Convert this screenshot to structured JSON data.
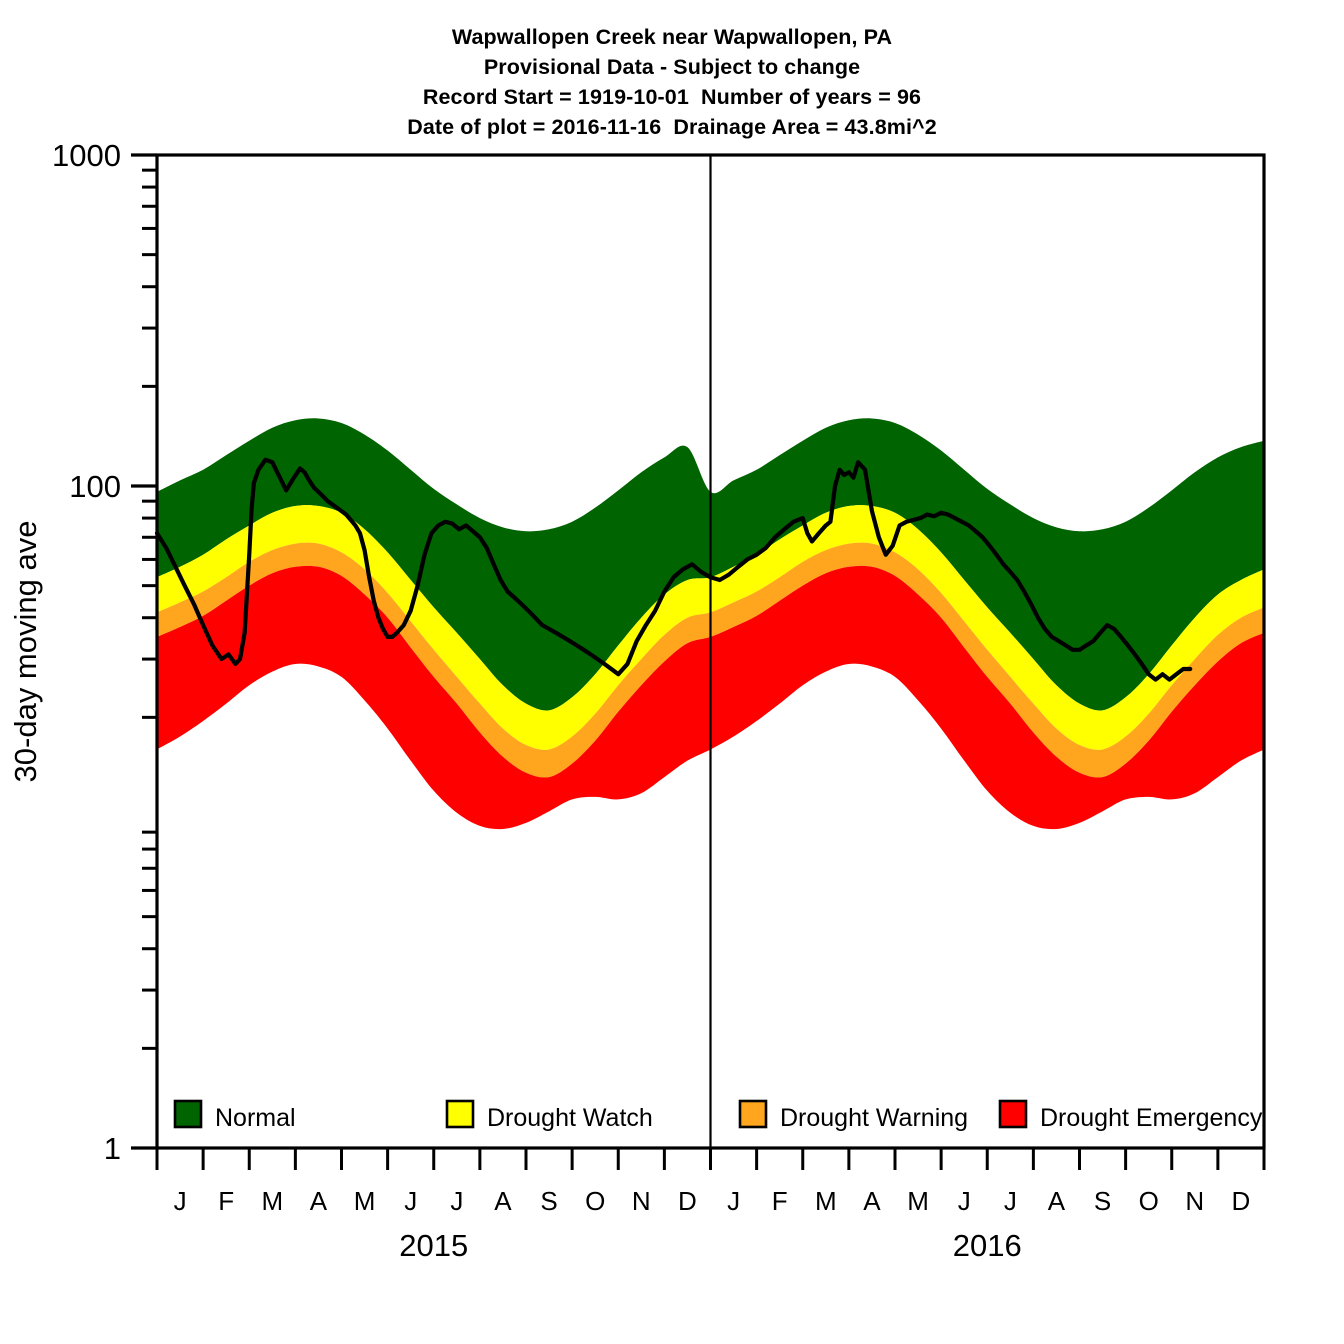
{
  "title": {
    "line1": "Wapwallopen Creek near Wapwallopen, PA",
    "line2": "Provisional Data - Subject to change",
    "line3": "Record Start = 1919-10-01  Number of years = 96",
    "line4": "Date of plot = 2016-11-16  Drainage Area = 43.8mi^2"
  },
  "legend": {
    "items": [
      {
        "label": "Normal",
        "color": "#006400"
      },
      {
        "label": "Drought Watch",
        "color": "#ffff00"
      },
      {
        "label": "Drought Warning",
        "color": "#ffa51e"
      },
      {
        "label": "Drought Emergency",
        "color": "#ff0000"
      }
    ]
  },
  "axes": {
    "ylabel": "30-day moving ave",
    "y_ticks_major": [
      "1",
      "100",
      "1000"
    ],
    "y_tick_values": [
      1,
      100,
      1000
    ],
    "y_minor_values": [
      2,
      3,
      4,
      5,
      6,
      7,
      8,
      9,
      20,
      30,
      40,
      50,
      60,
      70,
      80,
      90,
      200,
      300,
      400,
      500,
      600,
      700,
      800,
      900
    ],
    "ylim": [
      1,
      1000
    ],
    "x_months": [
      "J",
      "F",
      "M",
      "A",
      "M",
      "J",
      "J",
      "A",
      "S",
      "O",
      "N",
      "D"
    ],
    "year_labels": [
      "2015",
      "2016"
    ],
    "xlim": [
      "2015-01-01",
      "2016-12-31"
    ]
  },
  "chart_data": {
    "type": "area",
    "title": "Wapwallopen Creek near Wapwallopen, PA",
    "subtitle": "Provisional Data - Subject to change",
    "xlabel": "",
    "ylabel": "30-day moving ave",
    "yscale": "log",
    "ylim": [
      1,
      1000
    ],
    "grid": false,
    "legend_position": "bottom-inside",
    "x_unit": "month index (0 = 2015-01-01, 24 = 2017-01-01)",
    "x": [
      0,
      0.5,
      1,
      1.5,
      2,
      2.5,
      3,
      3.5,
      4,
      4.5,
      5,
      5.5,
      6,
      6.5,
      7,
      7.5,
      8,
      8.5,
      9,
      9.5,
      10,
      10.5,
      11,
      11.5,
      12,
      12.5,
      13,
      13.5,
      14,
      14.5,
      15,
      15.5,
      16,
      16.5,
      17,
      17.5,
      18,
      18.5,
      19,
      19.5,
      20,
      20.5,
      21,
      21.5,
      22,
      22.5,
      23,
      23.5,
      24
    ],
    "bands": [
      {
        "name": "Normal",
        "color": "#006400",
        "role": "upper envelope of normal band (90th-ish percentile)",
        "upper": [
          96,
          104,
          112,
          124,
          137,
          150,
          158,
          160,
          155,
          143,
          128,
          112,
          98,
          88,
          80,
          75,
          73,
          74,
          78,
          86,
          97,
          110,
          122,
          131,
          96,
          104,
          112,
          124,
          137,
          150,
          158,
          160,
          155,
          143,
          128,
          112,
          98,
          88,
          80,
          75,
          73,
          74,
          78,
          86,
          97,
          110,
          122,
          131,
          137
        ],
        "lower": [
          53,
          57,
          62,
          69,
          76,
          83,
          87,
          87,
          83,
          74,
          63,
          52,
          43,
          36,
          30,
          25,
          22,
          21,
          23,
          27,
          33,
          40,
          47,
          52,
          53,
          57,
          62,
          69,
          76,
          83,
          87,
          87,
          83,
          74,
          63,
          52,
          43,
          36,
          30,
          25,
          22,
          21,
          23,
          27,
          33,
          40,
          47,
          52,
          56
        ]
      },
      {
        "name": "Drought Watch",
        "color": "#ffff00",
        "upper": [
          53,
          57,
          62,
          69,
          76,
          83,
          87,
          87,
          83,
          74,
          63,
          52,
          43,
          36,
          30,
          25,
          22,
          21,
          23,
          27,
          33,
          40,
          47,
          52,
          53,
          57,
          62,
          69,
          76,
          83,
          87,
          87,
          83,
          74,
          63,
          52,
          43,
          36,
          30,
          25,
          22,
          21,
          23,
          27,
          33,
          40,
          47,
          52,
          56
        ],
        "lower": [
          41.5,
          44.5,
          48,
          53,
          59,
          64,
          67,
          67,
          63,
          56,
          47.5,
          39,
          32,
          26.5,
          22,
          18.5,
          16.5,
          16,
          17.5,
          20.5,
          25,
          30,
          35.5,
          40,
          41.5,
          44.5,
          48,
          53,
          59,
          64,
          67,
          67,
          63,
          56,
          47.5,
          39,
          32,
          26.5,
          22,
          18.5,
          16.5,
          16,
          17.5,
          20.5,
          25,
          30,
          35.5,
          40,
          43
        ]
      },
      {
        "name": "Drought Warning",
        "color": "#ffa51e",
        "upper": [
          41.5,
          44.5,
          48,
          53,
          59,
          64,
          67,
          67,
          63,
          56,
          47.5,
          39,
          32,
          26.5,
          22,
          18.5,
          16.5,
          16,
          17.5,
          20.5,
          25,
          30,
          35.5,
          40,
          41.5,
          44.5,
          48,
          53,
          59,
          64,
          67,
          67,
          63,
          56,
          47.5,
          39,
          32,
          26.5,
          22,
          18.5,
          16.5,
          16,
          17.5,
          20.5,
          25,
          30,
          35.5,
          40,
          43
        ],
        "lower": [
          35,
          37.5,
          40.5,
          45,
          50,
          54.5,
          57,
          57,
          53.5,
          47,
          40,
          32.5,
          26.5,
          22,
          18,
          15.2,
          13.6,
          13.2,
          14.5,
          17,
          20.8,
          25,
          29.5,
          33.5,
          35,
          37.5,
          40.5,
          45,
          50,
          54.5,
          57,
          57,
          53.5,
          47,
          40,
          32.5,
          26.5,
          22,
          18,
          15.2,
          13.6,
          13.2,
          14.5,
          17,
          20.8,
          25,
          29.5,
          33.5,
          36
        ]
      },
      {
        "name": "Drought Emergency",
        "color": "#ff0000",
        "upper": [
          35,
          37.5,
          40.5,
          45,
          50,
          54.5,
          57,
          57,
          53.5,
          47,
          40,
          32.5,
          26.5,
          22,
          18,
          15.2,
          13.6,
          13.2,
          14.5,
          17,
          20.8,
          25,
          29.5,
          33.5,
          35,
          37.5,
          40.5,
          45,
          50,
          54.5,
          57,
          57,
          53.5,
          47,
          40,
          32.5,
          26.5,
          22,
          18,
          15.2,
          13.6,
          13.2,
          14.5,
          17,
          20.8,
          25,
          29.5,
          33.5,
          36
        ],
        "lower": [
          16,
          17.5,
          19.5,
          22,
          25,
          27.5,
          29,
          28.5,
          26.5,
          22.5,
          18.5,
          14.8,
          12,
          10.3,
          9.4,
          9.2,
          9.6,
          10.4,
          11.3,
          11.5,
          11.3,
          11.8,
          13.2,
          14.8,
          16,
          17.5,
          19.5,
          22,
          25,
          27.5,
          29,
          28.5,
          26.5,
          22.5,
          18.5,
          14.8,
          12,
          10.3,
          9.4,
          9.2,
          9.6,
          10.4,
          11.3,
          11.5,
          11.3,
          11.8,
          13.2,
          14.8,
          16
        ]
      }
    ],
    "series": [
      {
        "name": "30-day moving average streamflow",
        "color": "#000000",
        "x": [
          0.0,
          0.2,
          0.4,
          0.6,
          0.8,
          1.0,
          1.2,
          1.4,
          1.55,
          1.7,
          1.8,
          1.9,
          2.0,
          2.05,
          2.1,
          2.2,
          2.35,
          2.5,
          2.65,
          2.8,
          2.95,
          3.1,
          3.2,
          3.3,
          3.4,
          3.5,
          3.6,
          3.7,
          3.8,
          3.9,
          4.0,
          4.1,
          4.2,
          4.3,
          4.4,
          4.5,
          4.6,
          4.7,
          4.8,
          4.9,
          5.0,
          5.1,
          5.2,
          5.35,
          5.5,
          5.65,
          5.8,
          5.95,
          6.1,
          6.25,
          6.4,
          6.55,
          6.7,
          6.85,
          7.0,
          7.15,
          7.3,
          7.45,
          7.6,
          7.75,
          7.9,
          8.05,
          8.2,
          8.35,
          8.5,
          8.65,
          8.8,
          8.95,
          9.1,
          9.25,
          9.4,
          9.55,
          9.7,
          9.85,
          10.0,
          10.2,
          10.4,
          10.6,
          10.8,
          11.0,
          11.2,
          11.4,
          11.6,
          11.8,
          12.0,
          12.2,
          12.4,
          12.6,
          12.8,
          13.0,
          13.2,
          13.4,
          13.6,
          13.8,
          14.0,
          14.1,
          14.2,
          14.35,
          14.5,
          14.6,
          14.7,
          14.8,
          14.9,
          15.0,
          15.1,
          15.2,
          15.35,
          15.5,
          15.65,
          15.8,
          15.95,
          16.1,
          16.25,
          16.4,
          16.55,
          16.7,
          16.85,
          17.0,
          17.15,
          17.3,
          17.45,
          17.6,
          17.75,
          17.9,
          18.05,
          18.2,
          18.35,
          18.5,
          18.65,
          18.8,
          18.95,
          19.1,
          19.25,
          19.4,
          19.55,
          19.7,
          19.85,
          20.0,
          20.15,
          20.3,
          20.45,
          20.6,
          20.75,
          20.9,
          21.05,
          21.2,
          21.35,
          21.5,
          21.65,
          21.8,
          21.95,
          22.1,
          22.25,
          22.4
        ],
        "y": [
          72,
          65,
          57,
          50,
          44,
          38,
          33,
          30,
          31,
          29,
          30,
          36,
          62,
          85,
          102,
          112,
          120,
          118,
          107,
          97,
          105,
          113,
          110,
          104,
          99,
          96,
          93,
          90,
          88,
          86,
          84,
          82,
          79,
          76,
          72,
          64,
          53,
          45,
          40,
          37,
          35,
          35,
          36,
          38,
          42,
          50,
          62,
          72,
          76,
          78,
          77,
          74,
          76,
          73,
          70,
          65,
          58,
          52,
          48,
          46,
          44,
          42,
          40,
          38,
          37,
          36,
          35,
          34,
          33,
          32,
          31,
          30,
          29,
          28,
          27,
          29,
          34,
          38,
          42,
          48,
          53,
          56,
          58,
          55,
          53,
          52,
          54,
          57,
          60,
          62,
          65,
          70,
          74,
          78,
          80,
          72,
          68,
          72,
          76,
          78,
          100,
          112,
          108,
          110,
          106,
          118,
          112,
          84,
          70,
          62,
          66,
          76,
          78,
          79,
          80,
          82,
          81,
          83,
          82,
          80,
          78,
          76,
          73,
          70,
          66,
          62,
          58,
          55,
          52,
          48,
          44,
          40,
          37,
          35,
          34,
          33,
          32,
          32,
          33,
          34,
          36,
          38,
          37,
          35,
          33,
          31,
          29,
          27,
          26,
          27,
          26,
          27,
          28,
          28
        ]
      }
    ],
    "annotations": [
      {
        "type": "vline",
        "x": 12,
        "label": "year boundary 2015/2016",
        "color": "#000000"
      }
    ]
  }
}
